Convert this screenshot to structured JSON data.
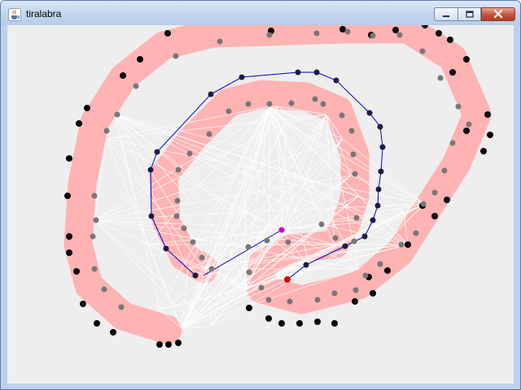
{
  "window": {
    "title": "tiralabra",
    "icon": "java-cup-icon",
    "controls": {
      "minimize": "minimize-icon",
      "maximize": "maximize-icon",
      "close": "close-icon"
    }
  },
  "visualization": {
    "track_color": "#ffb3b3",
    "edge_color": "#ffffff",
    "path_color": "#0000cc",
    "start_color": "#cc00cc",
    "goal_color": "#dd0000",
    "node_color": "#000000",
    "node_visited_color": "#777777"
  }
}
